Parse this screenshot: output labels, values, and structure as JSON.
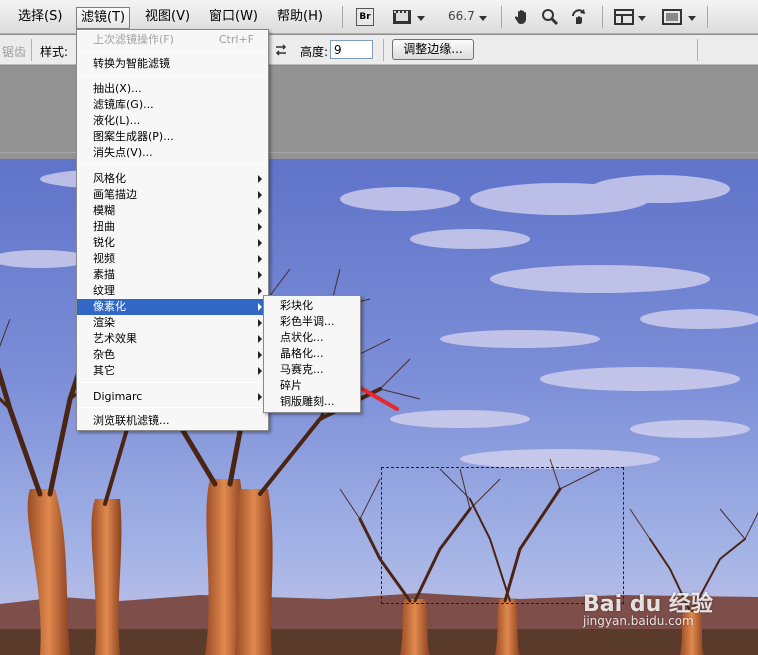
{
  "menubar": {
    "items": [
      {
        "label": "选择(S)"
      },
      {
        "label": "滤镜(T)"
      },
      {
        "label": "视图(V)"
      },
      {
        "label": "窗口(W)"
      },
      {
        "label": "帮助(H)"
      }
    ],
    "bridge_label": "Br",
    "zoom_value": "66.7"
  },
  "options_bar": {
    "antialias_label": "锯齿",
    "style_label": "样式:",
    "height_label": "高度:",
    "height_value": "9",
    "refine_edge_label": "调整边缘..."
  },
  "filter_menu": {
    "last_filter": {
      "label": "上次滤镜操作(F)",
      "shortcut": "Ctrl+F"
    },
    "convert_smart": "转换为智能滤镜",
    "group2": [
      "抽出(X)...",
      "滤镜库(G)...",
      "液化(L)...",
      "图案生成器(P)...",
      "消失点(V)..."
    ],
    "group3": [
      "风格化",
      "画笔描边",
      "模糊",
      "扭曲",
      "锐化",
      "视频",
      "素描",
      "纹理",
      "像素化",
      "渲染",
      "艺术效果",
      "杂色",
      "其它"
    ],
    "group4": [
      "Digimarc"
    ],
    "browse_online": "浏览联机滤镜..."
  },
  "pixelate_submenu": {
    "items": [
      "彩块化",
      "彩色半调...",
      "点状化...",
      "晶格化...",
      "马赛克...",
      "碎片",
      "铜版雕刻..."
    ]
  },
  "watermark": {
    "logo": "Bai du 经验",
    "url": "jingyan.baidu.com"
  },
  "colors": {
    "menu_highlight": "#3168c6",
    "annotation_arrow": "#e8262d"
  }
}
